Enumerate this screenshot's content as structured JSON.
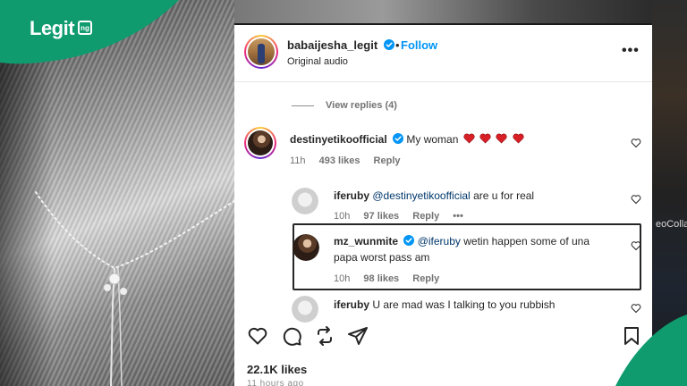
{
  "brand": {
    "logo_text": "Legit",
    "logo_suffix": "ng",
    "accent_color": "#0f9b6e"
  },
  "background": {
    "right_snippet": "eoColla"
  },
  "post": {
    "username": "babaijesha_legit",
    "follow_separator": "•",
    "follow_label": "Follow",
    "audio_label": "Original audio",
    "more_icon": "•••",
    "view_replies": "View replies (4)",
    "likes": "22.1K likes",
    "time_ago": "11 hours ago"
  },
  "comments": [
    {
      "username": "destinyetikoofficial",
      "verified": true,
      "mention": "",
      "text": "My woman",
      "hearts": 4,
      "time": "11h",
      "likes": "493 likes",
      "reply": "Reply"
    },
    {
      "username": "iferuby",
      "verified": false,
      "mention": "@destinyetikoofficial",
      "text": "are u for real",
      "time": "10h",
      "likes": "97 likes",
      "reply": "Reply",
      "more": "•••"
    },
    {
      "username": "mz_wunmite",
      "verified": true,
      "mention": "@iferuby",
      "text": "wetin happen some of una",
      "text_line2": "papa worst pass am",
      "time": "10h",
      "likes": "98 likes",
      "reply": "Reply"
    },
    {
      "username": "iferuby",
      "verified": false,
      "mention": "",
      "text": "U are mad was I talking to you rubbish"
    }
  ],
  "icons": {
    "verified": "verified-badge-icon",
    "heart": "heart-icon",
    "comment": "comment-icon",
    "repost": "repost-icon",
    "share": "share-icon",
    "save": "bookmark-icon"
  },
  "colors": {
    "link_blue": "#0095f6",
    "mention_blue": "#00376b",
    "heart_red": "#d81f26",
    "text_dark": "#262626",
    "text_muted": "#737373"
  }
}
